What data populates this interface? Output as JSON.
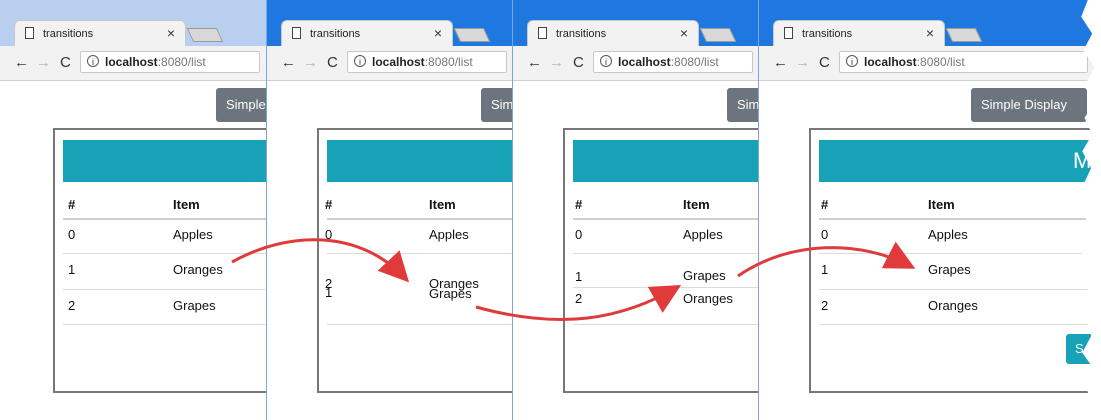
{
  "browser": {
    "tab_title": "transitions",
    "tab_close": "×",
    "url_host": "localhost",
    "url_rest": ":8080/list",
    "back": "←",
    "forward": "→",
    "reload": "C",
    "info": "i"
  },
  "frames": [
    {
      "button": "Simple",
      "banner": "",
      "headers": [
        "#",
        "Item"
      ],
      "rows": [
        {
          "num": "0",
          "item": "Apples"
        },
        {
          "num": "1",
          "item": "Oranges"
        },
        {
          "num": "2",
          "item": "Grapes"
        }
      ]
    },
    {
      "button": "Simp",
      "banner": "",
      "headers": [
        "#",
        "Item"
      ],
      "rows": [
        {
          "num": "0",
          "item": "Apples"
        },
        {
          "num": "2",
          "item": "Oranges"
        },
        {
          "num": "1",
          "item": "Grapes"
        }
      ]
    },
    {
      "button": "Sim",
      "banner": "",
      "headers": [
        "#",
        "Item"
      ],
      "rows": [
        {
          "num": "0",
          "item": "Apples"
        },
        {
          "num": "1",
          "item": "Grapes"
        },
        {
          "num": "2",
          "item": "Oranges"
        }
      ]
    },
    {
      "button": "Simple Display",
      "banner": "M",
      "headers": [
        "#",
        "Item"
      ],
      "rows": [
        {
          "num": "0",
          "item": "Apples"
        },
        {
          "num": "1",
          "item": "Grapes"
        },
        {
          "num": "2",
          "item": "Oranges"
        }
      ],
      "bottom_button": "S"
    }
  ],
  "colors": {
    "chrome_blue": "#1f78e0",
    "banner_teal": "#17a2b8",
    "button_gray": "#6c757d",
    "arrow_red": "#e03a3a"
  }
}
